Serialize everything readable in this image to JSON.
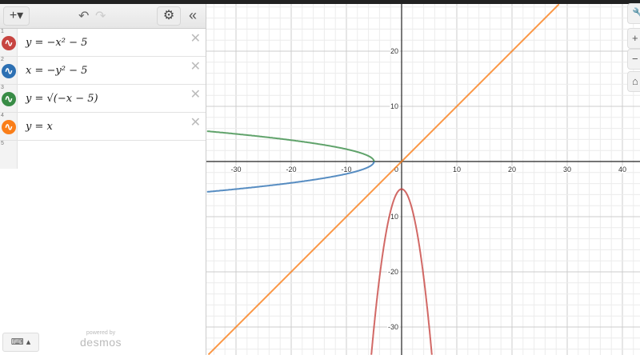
{
  "toolbar": {
    "add": "+▾",
    "undo": "↶",
    "redo": "↷",
    "settings": "⚙",
    "collapse": "«"
  },
  "expressions": [
    {
      "num": "1",
      "latex": "y = −x² − 5",
      "color": "#c74440"
    },
    {
      "num": "2",
      "latex": "x = −y² − 5",
      "color": "#2d70b3"
    },
    {
      "num": "3",
      "latex": "y = √(−x − 5)",
      "color": "#388c46"
    },
    {
      "num": "4",
      "latex": "y = x",
      "color": "#fa7e19"
    },
    {
      "num": "5",
      "latex": "",
      "color": ""
    }
  ],
  "delete_icon": "✕",
  "keyboard": "⌨ ▴",
  "powered": {
    "by": "powered by",
    "brand": "desmos"
  },
  "graph_buttons": {
    "wrench": "🔧",
    "zoom_in": "+",
    "zoom_out": "−",
    "home": "⌂"
  },
  "chart_data": {
    "type": "line",
    "xlim": [
      -35,
      43
    ],
    "ylim": [
      -35,
      29
    ],
    "x_ticks": [
      -30,
      -20,
      -10,
      10,
      20,
      30,
      40
    ],
    "y_ticks": [
      20,
      10,
      -10,
      -20,
      -30
    ],
    "origin_label": "0",
    "series": [
      {
        "name": "y=-x^2-5",
        "color": "#c74440"
      },
      {
        "name": "x=-y^2-5",
        "color": "#2d70b3"
      },
      {
        "name": "y=sqrt(-x-5)",
        "color": "#388c46"
      },
      {
        "name": "y=x",
        "color": "#fa7e19"
      }
    ]
  }
}
